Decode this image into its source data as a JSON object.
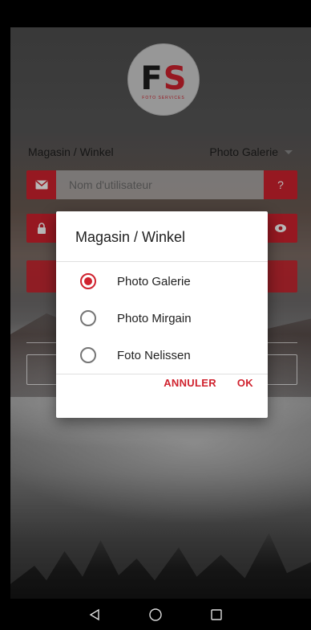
{
  "logo": {
    "mark_left": "F",
    "mark_right": "S",
    "subtitle": "FOTO SERVICES"
  },
  "shop": {
    "label": "Magasin / Winkel",
    "selected": "Photo Galerie"
  },
  "username": {
    "placeholder": "Nom d'utilisateur",
    "help_label": "?"
  },
  "dialog": {
    "title": "Magasin / Winkel",
    "options": [
      {
        "label": "Photo Galerie",
        "checked": true
      },
      {
        "label": "Photo Mirgain",
        "checked": false
      },
      {
        "label": "Foto Nelissen",
        "checked": false
      }
    ],
    "cancel_label": "ANNULER",
    "ok_label": "OK"
  },
  "icons": {
    "mail": "mail-icon",
    "lock": "lock-icon",
    "eye": "eye-icon",
    "back": "back-icon",
    "home": "home-icon",
    "recents": "recents-icon"
  },
  "colors": {
    "accent": "#d0222e",
    "dialog_bg": "#ffffff",
    "text": "#212121"
  }
}
